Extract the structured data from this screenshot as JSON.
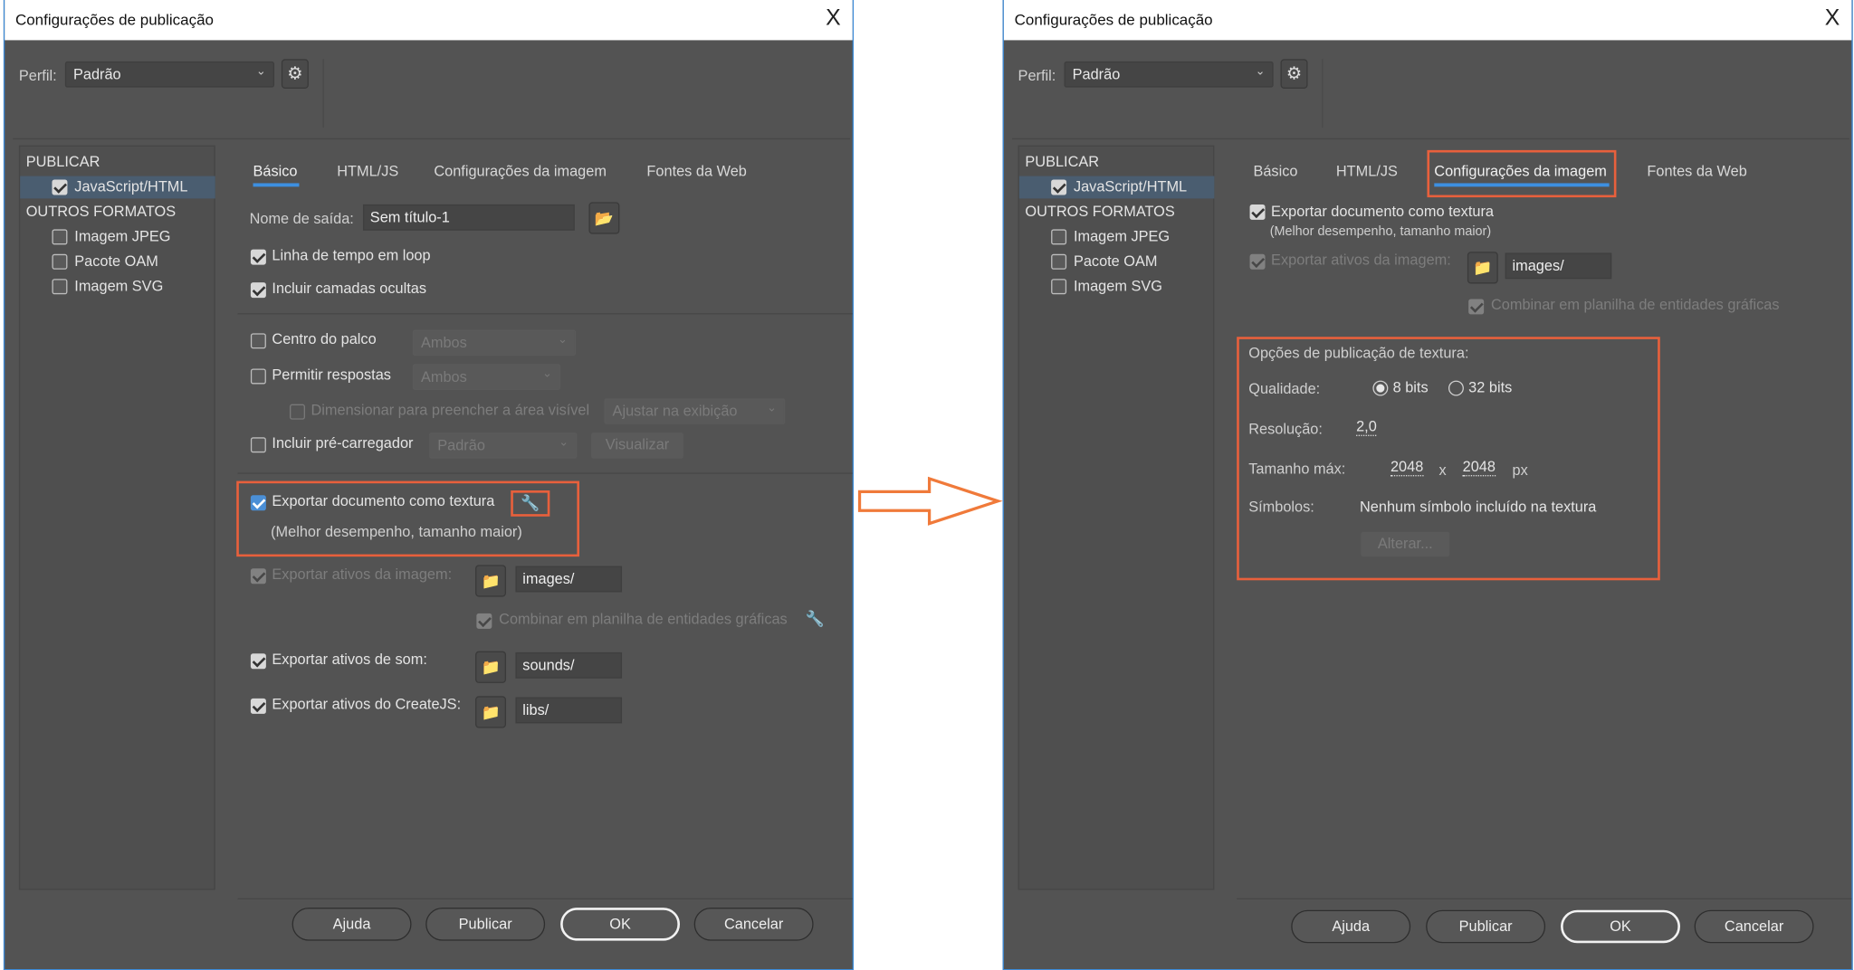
{
  "left_dialog": {
    "title": "Configurações de publicação",
    "close_glyph": "X",
    "profile_label": "Perfil:",
    "profile_value": "Padrão",
    "sidebar": {
      "publish_header": "PUBLICAR",
      "publish_items": [
        {
          "label": "JavaScript/HTML",
          "checked": true,
          "selected": true
        }
      ],
      "other_header": "OUTROS FORMATOS",
      "other_items": [
        {
          "label": "Imagem JPEG",
          "checked": false
        },
        {
          "label": "Pacote OAM",
          "checked": false
        },
        {
          "label": "Imagem SVG",
          "checked": false
        }
      ]
    },
    "tabs": [
      {
        "label": "Básico",
        "active": true
      },
      {
        "label": "HTML/JS"
      },
      {
        "label": "Configurações da imagem"
      },
      {
        "label": "Fontes da Web"
      }
    ],
    "output_name_label": "Nome de saída:",
    "output_name_value": "Sem título-1",
    "loop_timeline": "Linha de tempo em loop",
    "include_hidden_layers": "Incluir camadas ocultas",
    "center_stage": "Centro do palco",
    "center_stage_value": "Ambos",
    "responsive": "Permitir respostas",
    "responsive_value": "Ambos",
    "scale_fill": "Dimensionar para preencher a área visível",
    "scale_fill_value": "Ajustar na exibição",
    "include_preloader": "Incluir pré-carregador",
    "preloader_value": "Padrão",
    "preview_button": "Visualizar",
    "export_texture": "Exportar documento como textura",
    "export_texture_note": "(Melhor desempenho, tamanho maior)",
    "export_image_assets": "Exportar ativos da imagem:",
    "image_assets_path": "images/",
    "combine_spritesheet": "Combinar em planilha de entidades gráficas",
    "export_sound_assets": "Exportar ativos de som:",
    "sound_assets_path": "sounds/",
    "export_createjs_assets": "Exportar ativos do CreateJS:",
    "createjs_assets_path": "libs/",
    "buttons": {
      "help": "Ajuda",
      "publish": "Publicar",
      "ok": "OK",
      "cancel": "Cancelar"
    }
  },
  "right_dialog": {
    "title": "Configurações de publicação",
    "close_glyph": "X",
    "profile_label": "Perfil:",
    "profile_value": "Padrão",
    "sidebar": {
      "publish_header": "PUBLICAR",
      "publish_items": [
        {
          "label": "JavaScript/HTML",
          "checked": true,
          "selected": true
        }
      ],
      "other_header": "OUTROS FORMATOS",
      "other_items": [
        {
          "label": "Imagem JPEG",
          "checked": false
        },
        {
          "label": "Pacote OAM",
          "checked": false
        },
        {
          "label": "Imagem SVG",
          "checked": false
        }
      ]
    },
    "tabs": [
      {
        "label": "Básico"
      },
      {
        "label": "HTML/JS"
      },
      {
        "label": "Configurações da imagem",
        "active": true
      },
      {
        "label": "Fontes da Web"
      }
    ],
    "export_texture": "Exportar documento como textura",
    "export_texture_note": "(Melhor desempenho, tamanho maior)",
    "export_image_assets": "Exportar ativos da imagem:",
    "image_assets_path": "images/",
    "combine_spritesheet": "Combinar em planilha de entidades gráficas",
    "texture_options": {
      "header": "Opções de publicação de textura:",
      "quality_label": "Qualidade:",
      "quality_options": [
        "8 bits",
        "32 bits"
      ],
      "quality_selected": "8 bits",
      "resolution_label": "Resolução:",
      "resolution_value": "2,0",
      "max_size_label": "Tamanho máx:",
      "max_width": "2048",
      "times": "x",
      "max_height": "2048",
      "unit": "px",
      "symbols_label": "Símbolos:",
      "symbols_value": "Nenhum símbolo incluído na textura",
      "change_button": "Alterar..."
    },
    "buttons": {
      "help": "Ajuda",
      "publish": "Publicar",
      "ok": "OK",
      "cancel": "Cancelar"
    }
  },
  "colors": {
    "highlight": "#e8603c",
    "accent": "#3d8fe0",
    "dialog_bg": "#535353"
  },
  "icons": {
    "gear": "gear-icon",
    "folder": "folder-icon",
    "wrench": "wrench-icon",
    "arrow": "arrow-right-icon"
  }
}
